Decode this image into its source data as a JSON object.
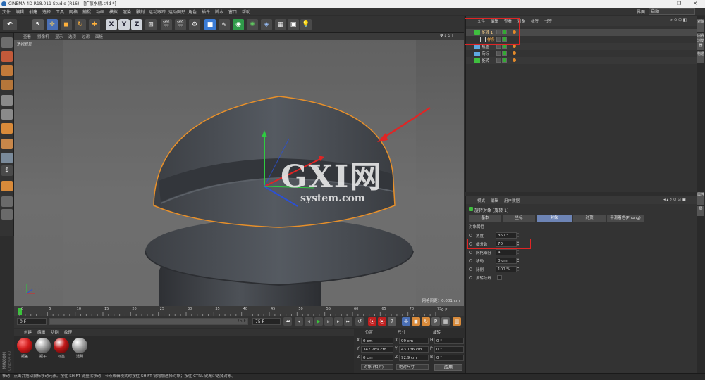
{
  "window": {
    "title": "CINEMA 4D R18.011 Studio (R16) - [扩散水瓶.c4d *]",
    "controls": [
      "—",
      "❐",
      "✕"
    ]
  },
  "menubar": {
    "items": [
      "文件",
      "编辑",
      "创建",
      "选择",
      "工具",
      "网格",
      "捕捉",
      "动画",
      "模拟",
      "渲染",
      "雕刻",
      "运动跟踪",
      "运动图形",
      "角色",
      "插件",
      "脚本",
      "窗口",
      "帮助"
    ],
    "layout_label": "界面",
    "layout_value": "启动"
  },
  "toolbar": {
    "undo": "undo-icon",
    "xyz": [
      "X",
      "Y",
      "Z"
    ]
  },
  "viewport": {
    "menus": [
      "查看",
      "摄像机",
      "显示",
      "选项",
      "过滤",
      "面板"
    ],
    "label": "透视视图",
    "grid_readout": "网格间距：0.001 cm"
  },
  "watermark": {
    "brand": "GXI网",
    "site": "system.com"
  },
  "timeline": {
    "ticks": [
      "0",
      "5",
      "10",
      "15",
      "20",
      "25",
      "30",
      "35",
      "40",
      "45",
      "50",
      "55",
      "60",
      "65",
      "70",
      "75"
    ],
    "end_frame": "0 F"
  },
  "transport": {
    "current_frame": "0 F",
    "range_end": "75 F",
    "max_frame": "75 F"
  },
  "material_manager": {
    "menus": [
      "创建",
      "编辑",
      "功能",
      "纹理"
    ],
    "materials": [
      {
        "name": "瓶盖",
        "color": "#d11b1b"
      },
      {
        "name": "瓶子",
        "color": "#8a8a8a"
      },
      {
        "name": "标签",
        "color": "#c21818"
      },
      {
        "name": "透明",
        "color": "#9a9a9a"
      }
    ]
  },
  "coordinates": {
    "headers": [
      "位置",
      "尺寸",
      "旋转"
    ],
    "rows": [
      {
        "axis": "X",
        "pos": "0 cm",
        "size_axis": "X",
        "size": "99 cm",
        "rot_axis": "H",
        "rot": "0 °"
      },
      {
        "axis": "Y",
        "pos": "347.289 cm",
        "size_axis": "Y",
        "size": "43.136 cm",
        "rot_axis": "P",
        "rot": "0 °"
      },
      {
        "axis": "Z",
        "pos": "0 cm",
        "size_axis": "Z",
        "size": "92.9 cm",
        "rot_axis": "B",
        "rot": "0 °"
      }
    ],
    "mode": "对象 (相对)",
    "size_mode": "绝对尺寸",
    "apply": "应用"
  },
  "status": {
    "text": "移动：点击并拖动鼠标移动元素。按住 SHIFT 键量化移动；节点编辑模式时按住 SHIFT 键增加选择对象；按住 CTRL 键减少选择对象。"
  },
  "object_manager": {
    "menus": [
      "文件",
      "编辑",
      "查看",
      "对象",
      "标签",
      "书签"
    ],
    "objects": [
      {
        "name": "旋转 1",
        "type": "lathe",
        "color": "#3fbf3f",
        "selected": true,
        "indent": 0
      },
      {
        "name": "样条",
        "type": "spline",
        "color": "#d8d8d8",
        "selected": false,
        "indent": 1
      },
      {
        "name": "瓶盖",
        "type": "cube",
        "color": "#5fa9e0",
        "selected": false,
        "indent": 0
      },
      {
        "name": "商标",
        "type": "plane",
        "color": "#5fa9e0",
        "selected": false,
        "indent": 0
      },
      {
        "name": "旋转",
        "type": "lathe",
        "color": "#3fbf3f",
        "selected": false,
        "indent": 0
      }
    ]
  },
  "attribute_manager": {
    "menus": [
      "模式",
      "编辑",
      "用户数据"
    ],
    "title": "旋转对象 [旋转 1]",
    "tabs": [
      "基本",
      "坐标",
      "对象",
      "封顶",
      "平滑着色(Phong)"
    ],
    "active_tab": "对象",
    "section": "对象属性",
    "params": [
      {
        "label": "角度",
        "value": "360 °"
      },
      {
        "label": "细分数",
        "value": "70"
      },
      {
        "label": "网格细分",
        "value": "4"
      },
      {
        "label": "移动",
        "value": "0 cm"
      },
      {
        "label": "比例",
        "value": "100 %"
      },
      {
        "label": "反转法线",
        "value": ""
      }
    ]
  },
  "side_tabs": [
    "对象",
    "内容浏览器",
    "构造",
    "属性",
    "层"
  ],
  "colors": {
    "highlight_box": "#e02525",
    "selection_outline": "#e8902a",
    "accent_tab": "#6d84b5"
  }
}
